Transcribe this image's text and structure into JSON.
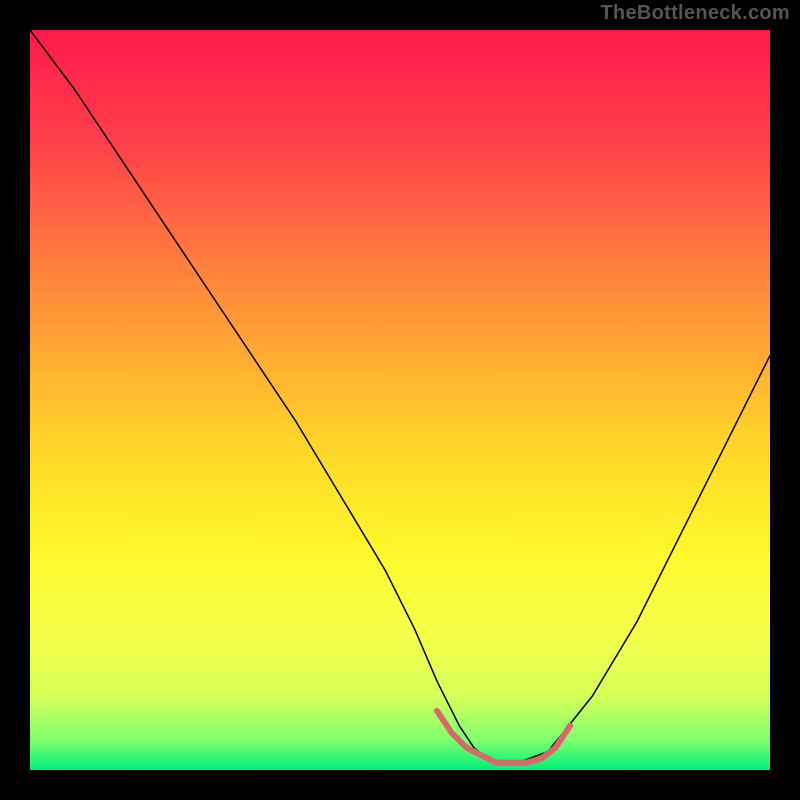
{
  "watermark": "TheBottleneck.com",
  "chart_data": {
    "type": "line",
    "title": "",
    "xlabel": "",
    "ylabel": "",
    "xlim": [
      0,
      100
    ],
    "ylim": [
      0,
      100
    ],
    "gradient_stops": [
      {
        "pos": 0.0,
        "color": "#ff1a4b"
      },
      {
        "pos": 0.15,
        "color": "#ff3f4a"
      },
      {
        "pos": 0.35,
        "color": "#ff8a3a"
      },
      {
        "pos": 0.55,
        "color": "#ffd22a"
      },
      {
        "pos": 0.7,
        "color": "#fff72a"
      },
      {
        "pos": 0.82,
        "color": "#f5ff4a"
      },
      {
        "pos": 0.9,
        "color": "#d6ff5a"
      },
      {
        "pos": 0.96,
        "color": "#7dff70"
      },
      {
        "pos": 1.0,
        "color": "#00f07a"
      }
    ],
    "series": [
      {
        "name": "bottleneck-curve",
        "color": "#000000",
        "width": 1.5,
        "x": [
          0,
          6,
          12,
          18,
          24,
          30,
          36,
          42,
          48,
          52,
          55,
          58,
          60,
          62,
          64,
          66,
          70,
          76,
          82,
          88,
          94,
          100
        ],
        "values": [
          100,
          92,
          83,
          74,
          65,
          56,
          47,
          37,
          27,
          19,
          12,
          6,
          3,
          1.5,
          1,
          1,
          2.5,
          10,
          20,
          32,
          44,
          56
        ]
      },
      {
        "name": "optimal-region-marker",
        "color": "#d66a6a",
        "width": 6,
        "x": [
          55,
          57,
          59,
          61,
          63,
          65,
          67,
          69,
          71,
          73
        ],
        "values": [
          8,
          5,
          3,
          2,
          1,
          1,
          1,
          1.5,
          3,
          6
        ]
      }
    ]
  }
}
